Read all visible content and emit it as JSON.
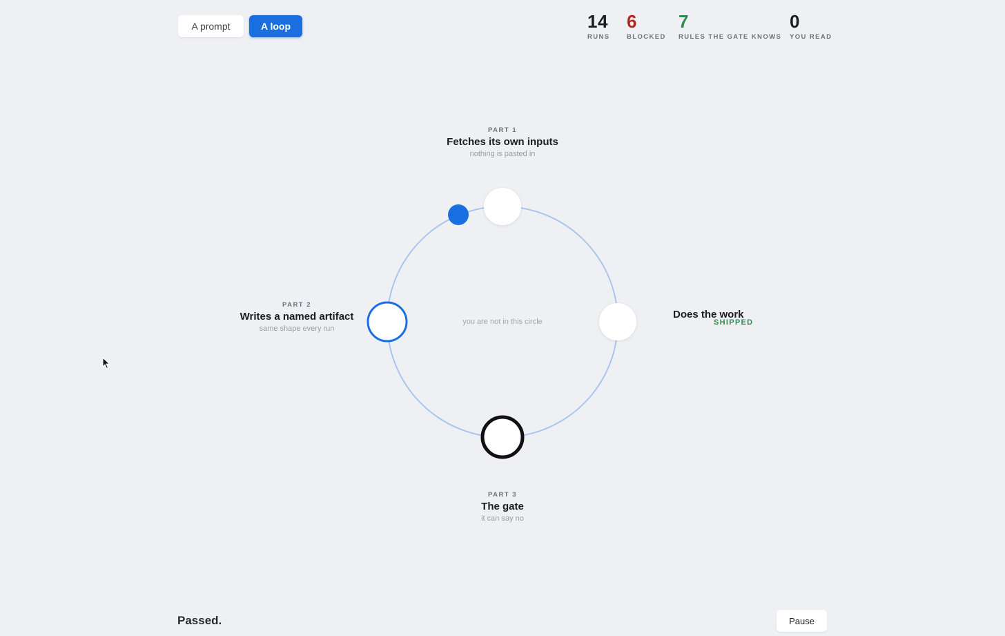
{
  "toggle": {
    "prompt_label": "A prompt",
    "loop_label": "A loop",
    "active": "loop"
  },
  "stats": {
    "runs": {
      "value": "14",
      "label": "RUNS",
      "color": "#1c1c1e"
    },
    "blocked": {
      "value": "6",
      "label": "BLOCKED",
      "color": "#b3261e"
    },
    "rules": {
      "value": "7",
      "label": "RULES THE GATE KNOWS",
      "color": "#2e8b4e"
    },
    "you_read": {
      "value": "0",
      "label": "YOU READ",
      "color": "#1c1c1e"
    }
  },
  "loop": {
    "center_note": "you are not in this circle",
    "part1": {
      "tag": "PART 1",
      "title": "Fetches its own inputs",
      "sub": "nothing is pasted in"
    },
    "part2": {
      "tag": "PART 2",
      "title": "Writes a named artifact",
      "sub": "same shape every run"
    },
    "part3": {
      "tag": "PART 3",
      "title": "The gate",
      "sub": "it can say no"
    },
    "work": {
      "title": "Does the work",
      "status": "SHIPPED"
    }
  },
  "colors": {
    "accent": "#1a6fe0",
    "ring": "#aac4ee",
    "background": "#eff0f4",
    "shipped": "#2e8b4e"
  },
  "footer": {
    "status": "Passed.",
    "pause_label": "Pause"
  }
}
